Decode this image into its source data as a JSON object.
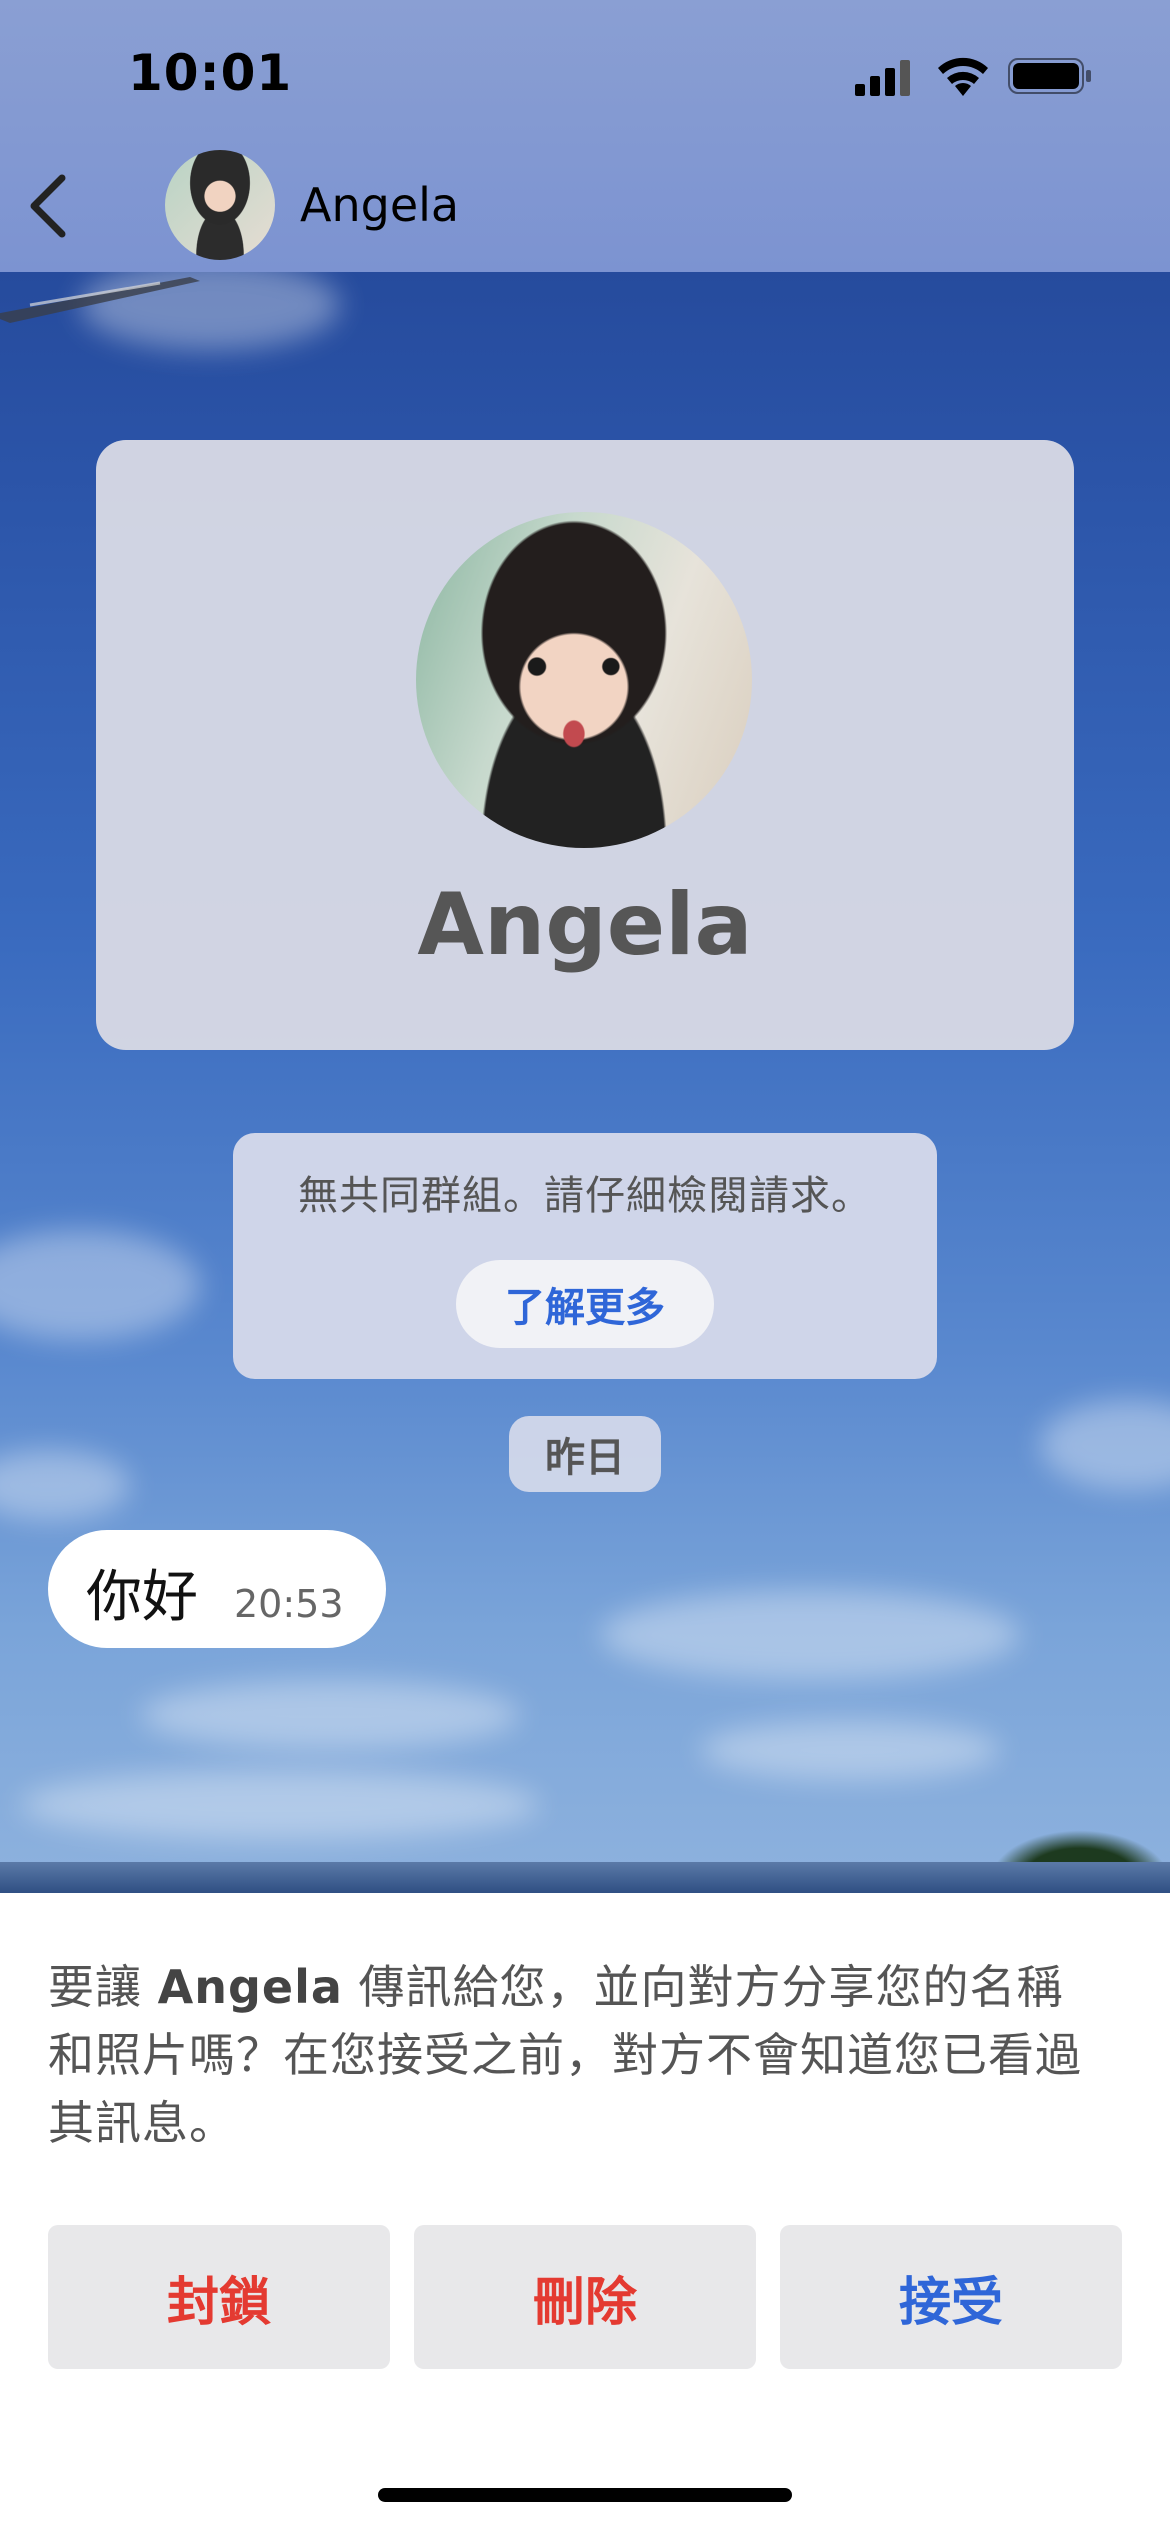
{
  "status_bar": {
    "time": "10:01",
    "icons": [
      "cellular-signal-icon",
      "wifi-icon",
      "battery-icon"
    ]
  },
  "header": {
    "back_icon": "chevron-left-icon",
    "contact_name": "Angela"
  },
  "profile_card": {
    "name": "Angela"
  },
  "notice": {
    "text": "無共同群組。請仔細檢閱請求。",
    "learn_more_label": "了解更多"
  },
  "date_chip": "昨日",
  "messages": [
    {
      "text": "你好",
      "time": "20:53"
    }
  ],
  "request_prompt": {
    "before_name": "要讓 ",
    "name": "Angela",
    "after_name": " 傳訊給您，並向對方分享您的名稱和照片嗎？在您接受之前，對方不會知道您已看過其訊息。"
  },
  "actions": {
    "block_label": "封鎖",
    "delete_label": "刪除",
    "accept_label": "接受"
  },
  "colors": {
    "accent_blue": "#2f66d8",
    "danger_red": "#e43a31",
    "header_bg": "#7c93d1"
  }
}
